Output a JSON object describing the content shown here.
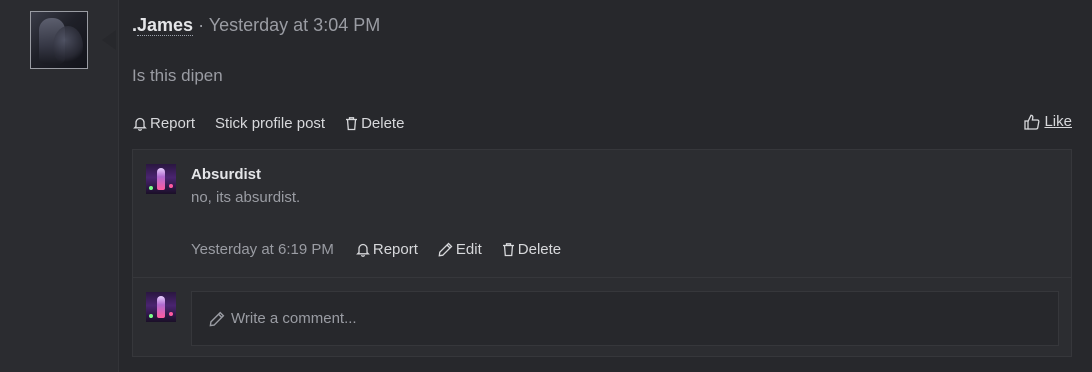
{
  "post": {
    "author": "James",
    "author_prefix": ".",
    "separator": "·",
    "timestamp": "Yesterday at 3:04 PM",
    "body": "Is this dipen",
    "actions": {
      "report": "Report",
      "stick": "Stick profile post",
      "delete": "Delete",
      "like": "Like"
    }
  },
  "comment": {
    "author": "Absurdist",
    "text": "no, its absurdist.",
    "timestamp": "Yesterday at 6:19 PM",
    "actions": {
      "report": "Report",
      "edit": "Edit",
      "delete": "Delete"
    }
  },
  "composer": {
    "placeholder": "Write a comment..."
  },
  "icons": {
    "report": "bell-icon",
    "delete": "trash-icon",
    "edit": "pencil-icon",
    "like": "thumbs-up-icon",
    "composer": "pencil-icon"
  },
  "colors": {
    "background": "#27282c",
    "panel": "#2c2d31",
    "text": "#d7d8db",
    "muted": "#9a9ca3"
  }
}
